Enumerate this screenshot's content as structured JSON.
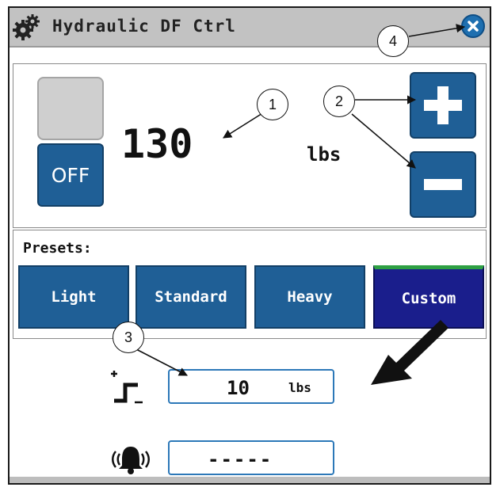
{
  "window": {
    "title": "Hydraulic DF Ctrl"
  },
  "control": {
    "value": "130",
    "unit": "lbs",
    "toggle_label": "OFF"
  },
  "presets": {
    "label": "Presets:",
    "items": [
      "Light",
      "Standard",
      "Heavy",
      "Custom"
    ],
    "selected": "Custom"
  },
  "increment": {
    "value": "10",
    "unit": "lbs"
  },
  "alarm": {
    "value": "-----"
  },
  "callouts": [
    "1",
    "2",
    "3",
    "4"
  ],
  "colors": {
    "button_blue": "#1f5f96",
    "selected_preset": "#1a1e8c",
    "selected_indicator": "#2ea043",
    "field_border": "#2c78b8"
  },
  "icons": [
    "gear-icon",
    "close-icon",
    "plus-icon",
    "minus-icon",
    "step-increment-icon",
    "alarm-bell-icon"
  ]
}
